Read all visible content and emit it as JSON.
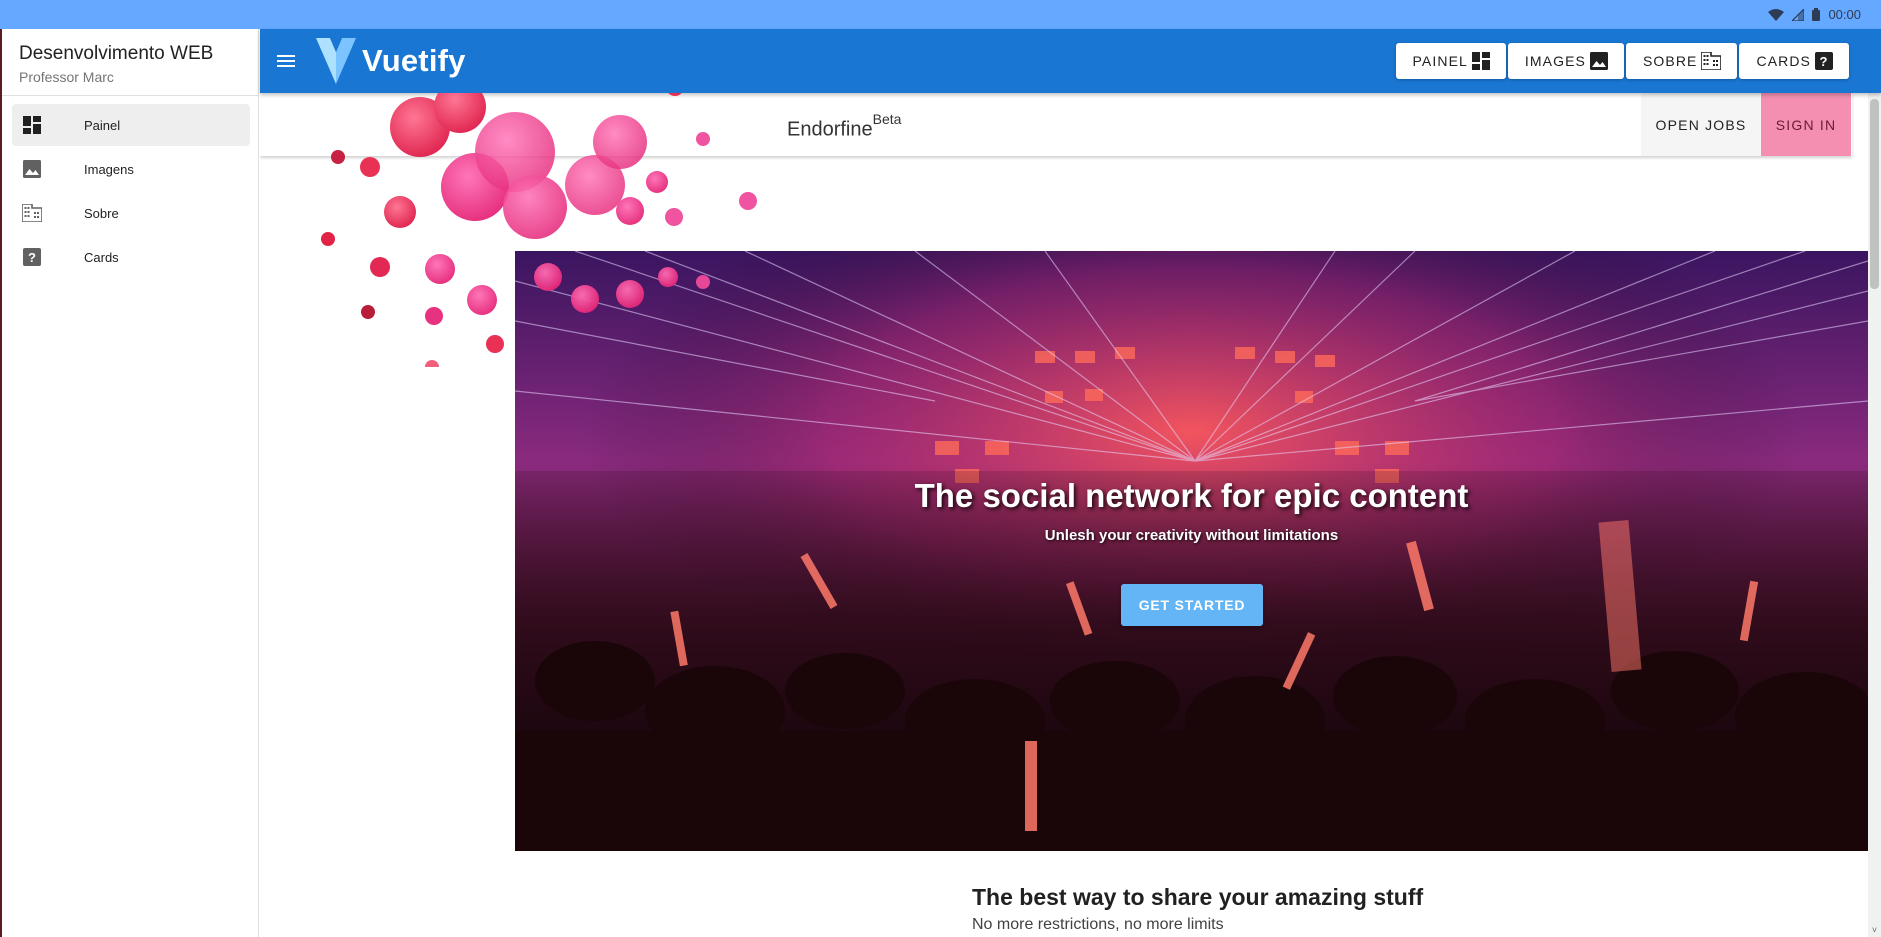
{
  "status_bar": {
    "time": "00:00"
  },
  "drawer": {
    "title": "Desenvolvimento WEB",
    "subtitle": "Professor Marc",
    "items": [
      {
        "label": "Painel",
        "icon": "dashboard-icon",
        "active": true
      },
      {
        "label": "Imagens",
        "icon": "image-icon",
        "active": false
      },
      {
        "label": "Sobre",
        "icon": "business-icon",
        "active": false
      },
      {
        "label": "Cards",
        "icon": "help-box-icon",
        "active": false
      }
    ]
  },
  "app_bar": {
    "brand": "Vuetify",
    "color": "#1976d2",
    "buttons": [
      {
        "label": "PAINEL",
        "icon": "dashboard-icon"
      },
      {
        "label": "IMAGES",
        "icon": "image-icon"
      },
      {
        "label": "SOBRE",
        "icon": "business-icon"
      },
      {
        "label": "CARDS",
        "icon": "help-box-icon"
      }
    ]
  },
  "site_toolbar": {
    "title": "Endorfine",
    "badge": "Beta",
    "open_jobs": "OPEN JOBS",
    "sign_in": "SIGN IN",
    "sign_in_color": "#f48fb1"
  },
  "hero": {
    "title": "The social network for epic content",
    "subtitle": "Unlesh your creativity without limitations",
    "cta": "GET STARTED",
    "cta_color": "#64b5f6"
  },
  "section": {
    "title": "The best way to share your amazing stuff",
    "subtitle": "No more restrictions, no more limits"
  }
}
